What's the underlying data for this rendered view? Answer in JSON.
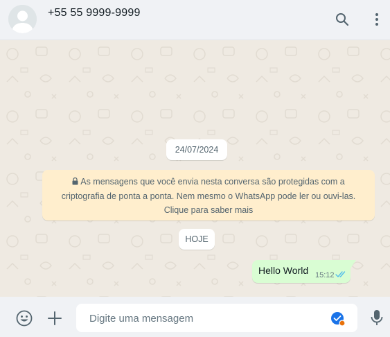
{
  "header": {
    "contact_name": "+55 55 9999-9999",
    "icons": [
      "default-avatar-icon",
      "search-icon",
      "kebab-menu-icon"
    ]
  },
  "chat": {
    "date_divider": "24/07/2024",
    "encryption_notice": "As mensagens que você envia nesta conversa são protegidas com a criptografia de ponta a ponta. Nem mesmo o WhatsApp pode ler ou ouvi-las. Clique para saber mais",
    "today_divider": "HOJE",
    "messages": [
      {
        "text": "Hello World",
        "time": "15:12",
        "direction": "outgoing",
        "status": "read"
      }
    ]
  },
  "composer": {
    "placeholder": "Digite uma mensagem",
    "value": "",
    "icons": [
      "emoji-icon",
      "plus-icon",
      "grammar-check-icon",
      "microphone-icon"
    ]
  },
  "colors": {
    "header_bg": "#f0f2f5",
    "chat_bg": "#efeae2",
    "outgoing_bubble": "#d9fdd3",
    "notice_bg": "#ffeecd",
    "read_ticks": "#53bdeb",
    "icon": "#54656f"
  }
}
